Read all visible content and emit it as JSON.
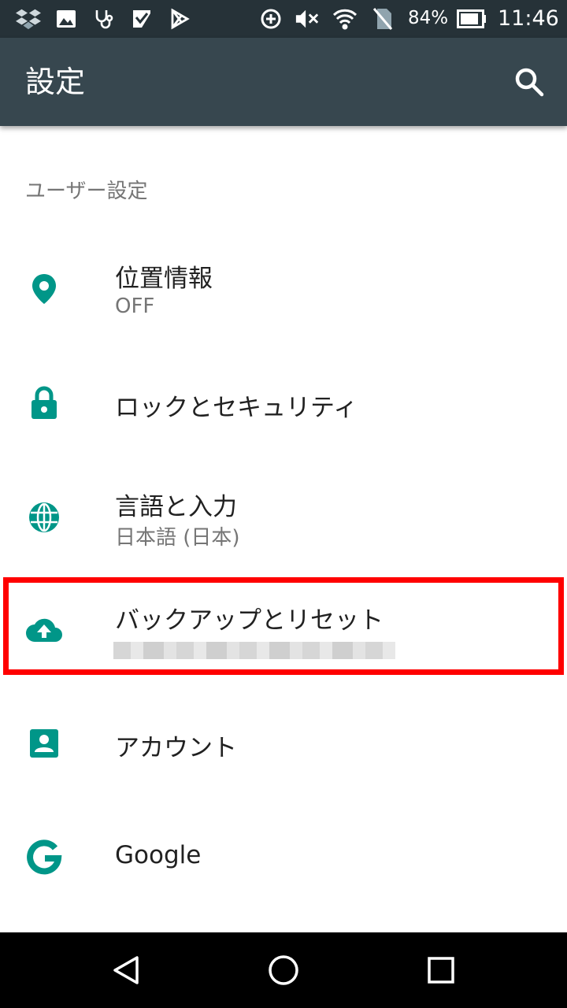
{
  "status_bar": {
    "battery_percent": "84%",
    "time": "11:46",
    "icons": [
      "dropbox-icon",
      "image-icon",
      "stethoscope-icon",
      "checkmark-app-icon",
      "play-store-icon",
      "data-saver-icon",
      "mute-icon",
      "wifi-icon",
      "no-sim-icon",
      "battery-icon"
    ]
  },
  "app_bar": {
    "title": "設定",
    "search_icon": "search-icon"
  },
  "section": {
    "header": "ユーザー設定"
  },
  "items": [
    {
      "title": "位置情報",
      "summary": "OFF",
      "icon": "location-icon"
    },
    {
      "title": "ロックとセキュリティ",
      "summary": "",
      "icon": "lock-icon"
    },
    {
      "title": "言語と入力",
      "summary": "日本語 (日本)",
      "icon": "globe-icon"
    },
    {
      "title": "バックアップとリセット",
      "summary": "",
      "icon": "cloud-upload-icon"
    },
    {
      "title": "アカウント",
      "summary": "",
      "icon": "account-icon"
    },
    {
      "title": "Google",
      "summary": "",
      "icon": "google-icon"
    }
  ],
  "colors": {
    "accent": "#009688",
    "app_bar": "#37474f",
    "status_bar": "#263238",
    "highlight": "#ff0000"
  },
  "nav_bar": {
    "icons": [
      "back-icon",
      "home-icon",
      "recents-icon"
    ]
  }
}
